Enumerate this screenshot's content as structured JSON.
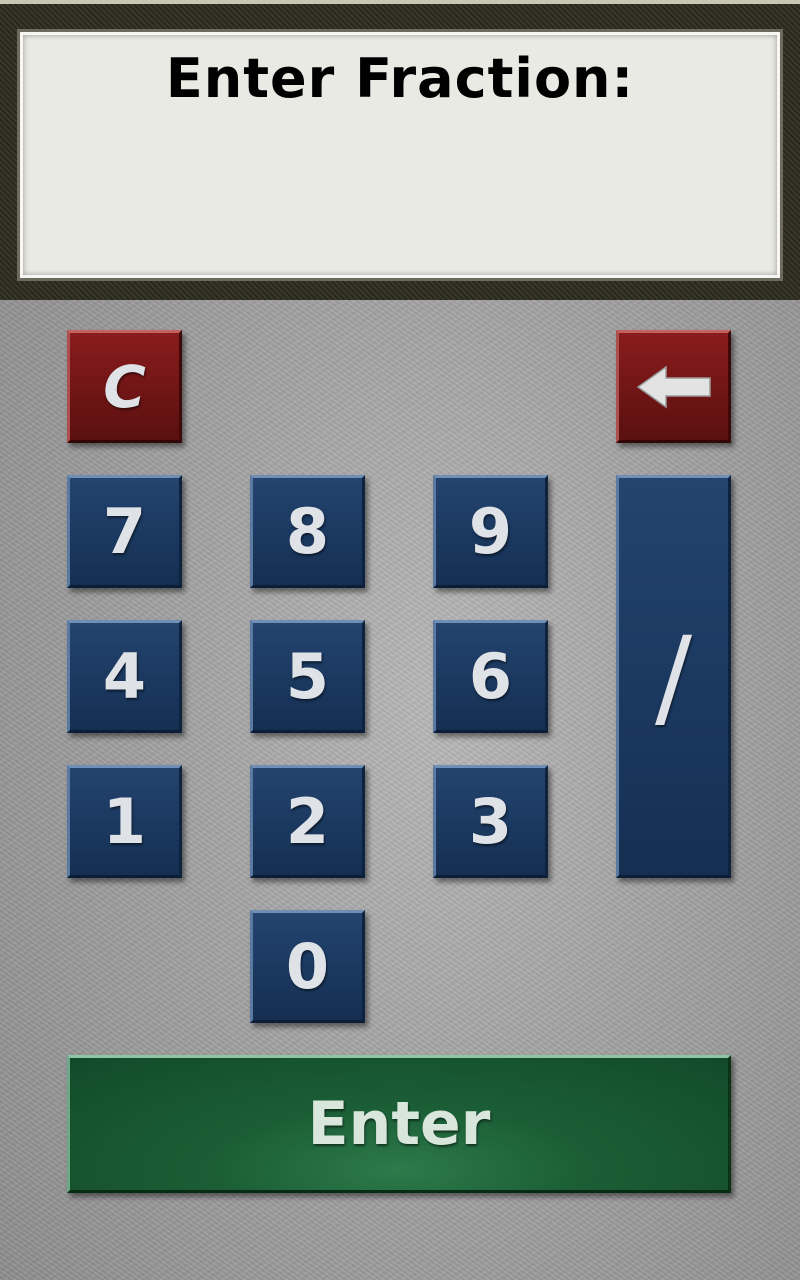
{
  "display": {
    "title": "Enter Fraction:",
    "value": ""
  },
  "keypad": {
    "clear_label": "C",
    "backspace_icon": "left-arrow-icon",
    "digits": {
      "d0": "0",
      "d1": "1",
      "d2": "2",
      "d3": "3",
      "d4": "4",
      "d5": "5",
      "d6": "6",
      "d7": "7",
      "d8": "8",
      "d9": "9"
    },
    "slash_label": "/",
    "enter_label": "Enter"
  },
  "colors": {
    "digit_key": "#1c3a62",
    "control_key": "#701515",
    "enter_key": "#1b5e36",
    "display_bg": "#e9eae4",
    "frame": "#2a2920"
  }
}
